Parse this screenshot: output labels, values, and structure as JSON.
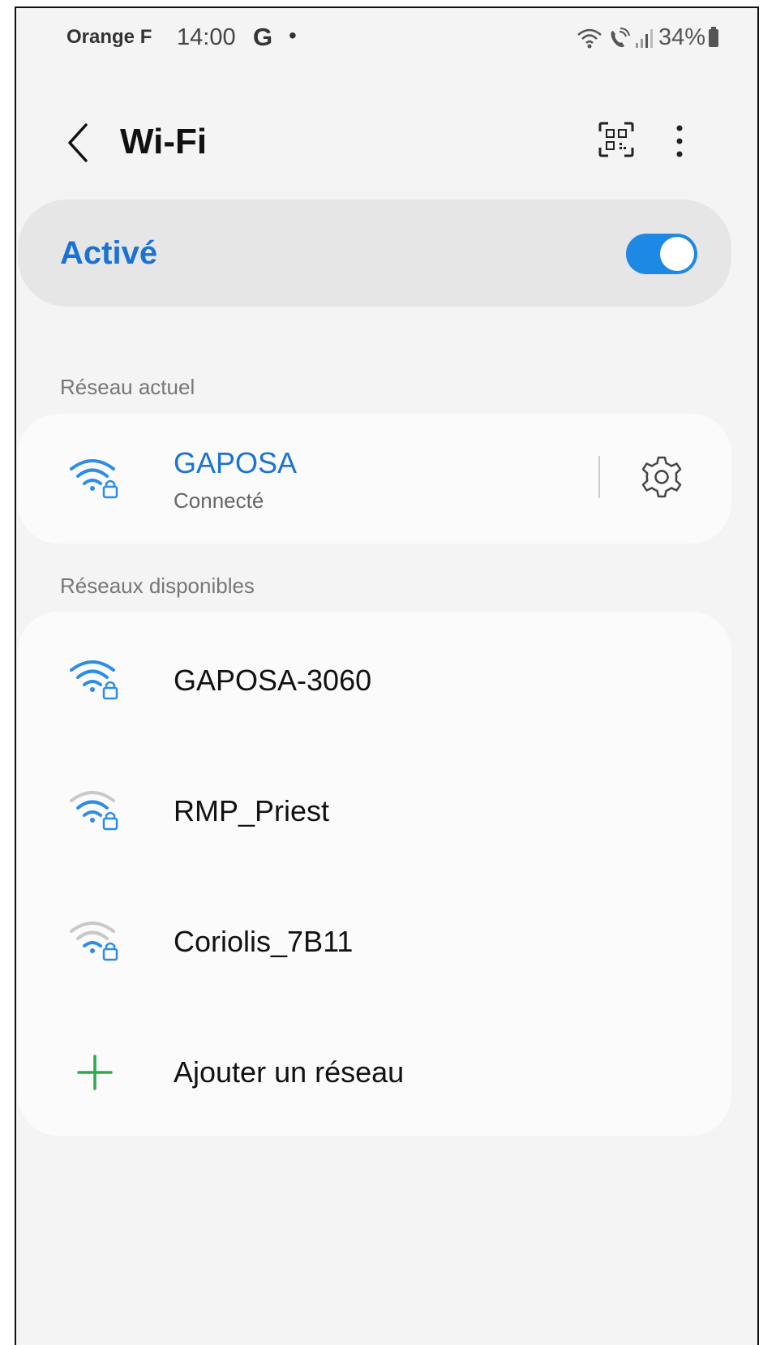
{
  "status_bar": {
    "carrier": "Orange F",
    "time": "14:00",
    "g_badge": "G",
    "dot": "•",
    "battery_percent": "34%"
  },
  "header": {
    "title": "Wi-Fi",
    "back_icon": "chevron-left-icon",
    "qr_icon": "qr-scan-icon",
    "more_icon": "more-vert-icon"
  },
  "wifi_toggle": {
    "label": "Activé",
    "on": true
  },
  "current_network": {
    "section_label": "Réseau actuel",
    "name": "GAPOSA",
    "status": "Connecté",
    "signal_icon": "wifi-lock-icon",
    "settings_icon": "gear-icon"
  },
  "available_networks": {
    "section_label": "Réseaux disponibles",
    "networks": [
      {
        "name": "GAPOSA-3060",
        "signal_bars": 3
      },
      {
        "name": "RMP_Priest",
        "signal_bars": 2
      },
      {
        "name": "Coriolis_7B11",
        "signal_bars": 1
      }
    ],
    "add_network_label": "Ajouter un réseau"
  },
  "colors": {
    "accent": "#1a73d4",
    "switch": "#1e88e5",
    "add_icon": "#2eaa4a",
    "signal_inactive": "#c8c8c8"
  }
}
